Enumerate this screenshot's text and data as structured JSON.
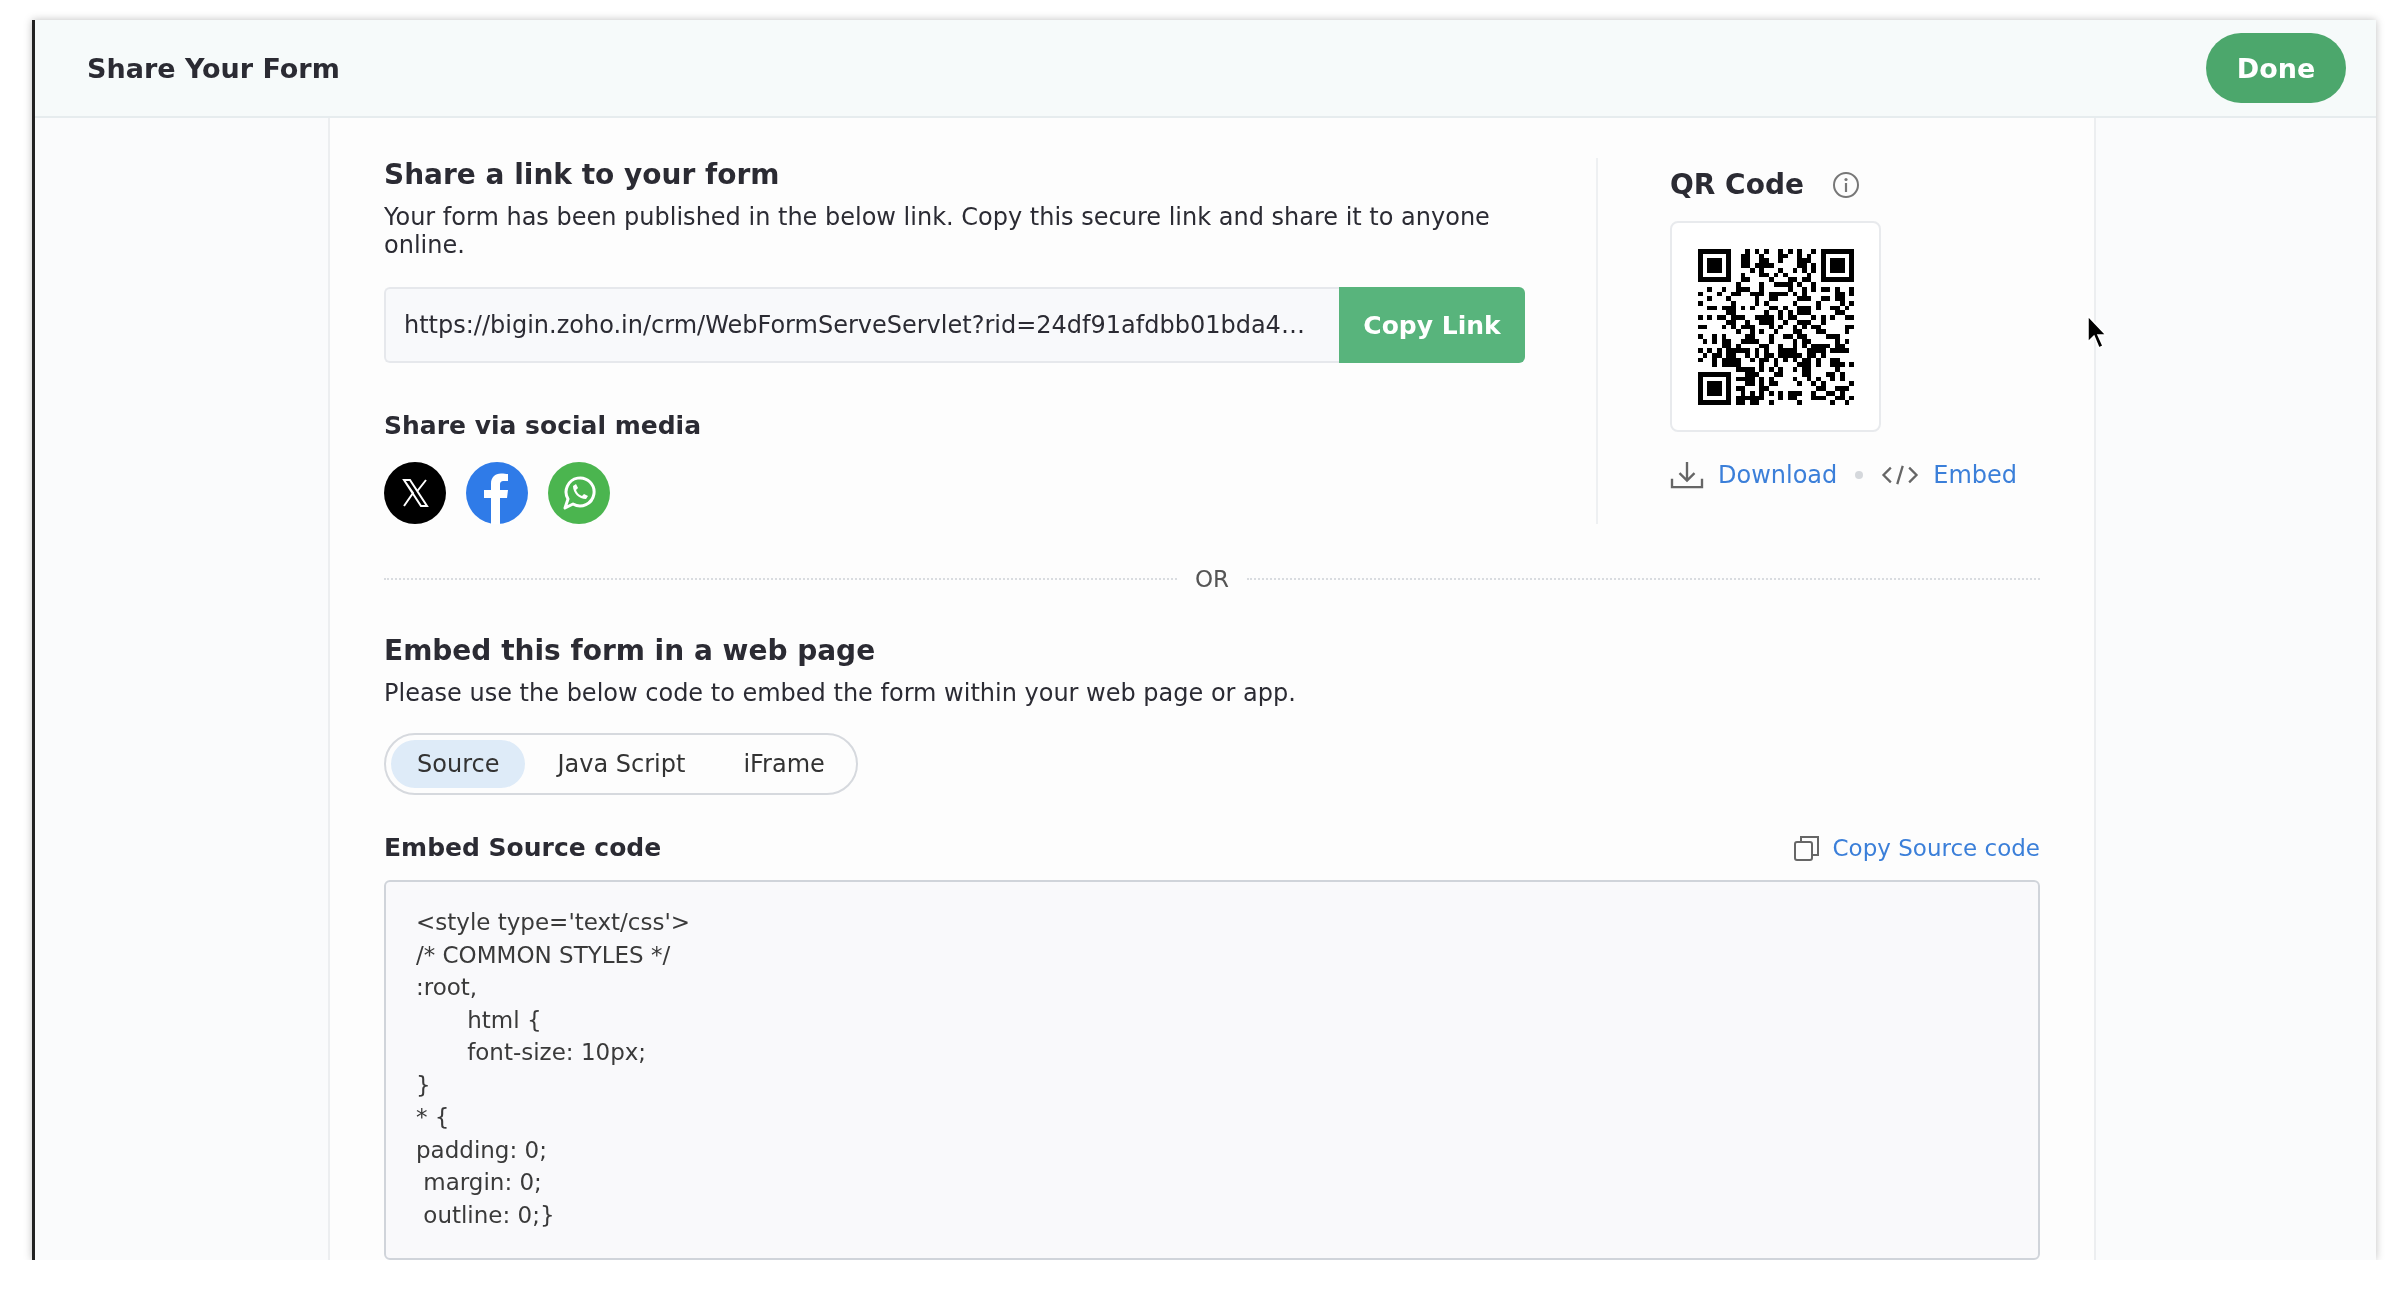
{
  "header": {
    "title": "Share Your Form",
    "done_button": "Done"
  },
  "link_section": {
    "heading": "Share a link to your form",
    "description": "Your form has been published in the below link. Copy this secure link and share it to anyone online.",
    "link": "https://bigin.zoho.in/crm/WebFormServeServlet?rid=24df91afdbb01bda4…",
    "copy_button": "Copy Link",
    "social_heading": "Share via social media"
  },
  "qr_section": {
    "heading": "QR Code",
    "download": "Download",
    "embed": "Embed"
  },
  "separator": "OR",
  "embed_section": {
    "heading": "Embed this form in a web page",
    "description": "Please use the below code to embed the form within your web page or app.",
    "tabs": [
      {
        "label": "Source",
        "selected": true
      },
      {
        "label": "Java Script",
        "selected": false
      },
      {
        "label": "iFrame",
        "selected": false
      }
    ],
    "code_heading": "Embed Source code",
    "copy_code": "Copy Source code",
    "code_lines": [
      "<style type='text/css'>",
      "/* COMMON STYLES */",
      ":root,",
      "       html {",
      "       font-size: 10px;",
      "}",
      "* {",
      "padding: 0;",
      " margin: 0;",
      " outline: 0;}"
    ]
  }
}
